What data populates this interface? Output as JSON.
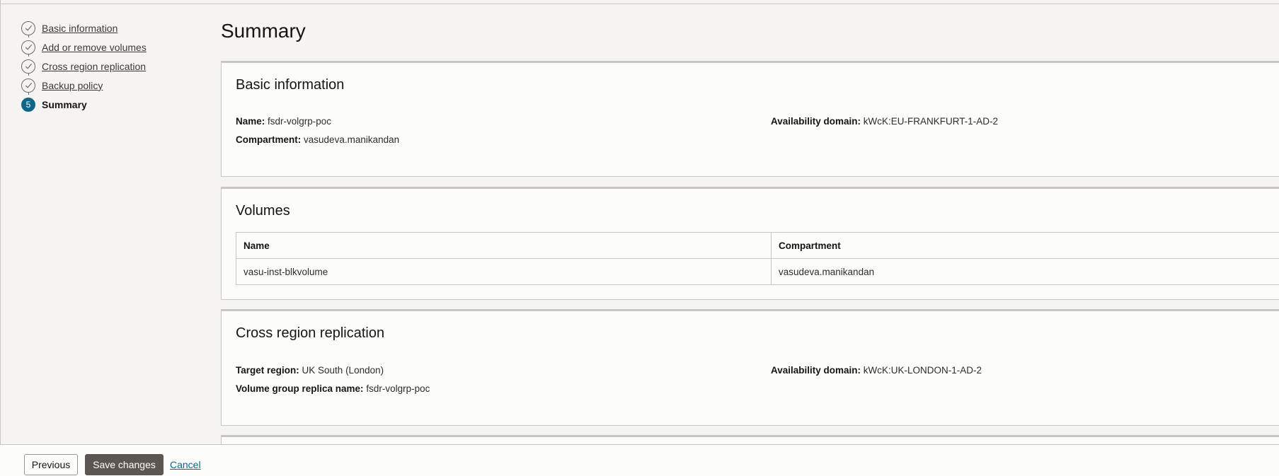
{
  "steps": [
    {
      "label": "Basic information",
      "state": "done"
    },
    {
      "label": "Add or remove volumes",
      "state": "done"
    },
    {
      "label": "Cross region replication",
      "state": "done"
    },
    {
      "label": "Backup policy",
      "state": "done"
    },
    {
      "label": "Summary",
      "state": "current",
      "number": "5"
    }
  ],
  "page": {
    "title": "Summary"
  },
  "basic_info": {
    "title": "Basic information",
    "name_label": "Name:",
    "name_value": "fsdr-volgrp-poc",
    "compartment_label": "Compartment:",
    "compartment_value": "vasudeva.manikandan",
    "ad_label": "Availability domain:",
    "ad_value": "kWcK:EU-FRANKFURT-1-AD-2"
  },
  "volumes": {
    "title": "Volumes",
    "columns": [
      "Name",
      "Compartment"
    ],
    "rows": [
      [
        "vasu-inst-blkvolume",
        "vasudeva.manikandan"
      ]
    ]
  },
  "replication": {
    "title": "Cross region replication",
    "target_region_label": "Target region:",
    "target_region_value": "UK South (London)",
    "replica_name_label": "Volume group replica name:",
    "replica_name_value": "fsdr-volgrp-poc",
    "ad_label": "Availability domain:",
    "ad_value": "kWcK:UK-LONDON-1-AD-2"
  },
  "footer": {
    "previous_label": "Previous",
    "save_label": "Save changes",
    "cancel_label": "Cancel"
  },
  "colors": {
    "accent": "#0e6689",
    "primary_button": "#5b5652"
  }
}
